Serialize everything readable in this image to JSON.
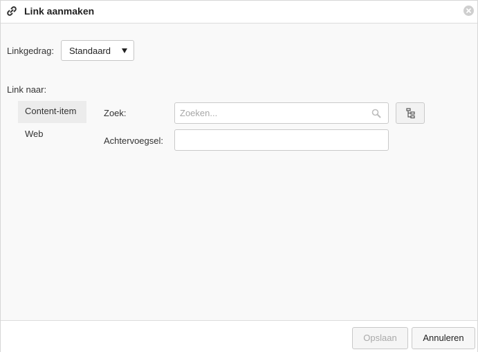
{
  "dialog": {
    "title": "Link aanmaken",
    "title_icon": "link-icon",
    "close_icon": "close-icon"
  },
  "behavior": {
    "label": "Linkgedrag:",
    "selected": "Standaard"
  },
  "link_to": {
    "label": "Link naar:",
    "tabs": [
      {
        "label": "Content-item",
        "active": true
      },
      {
        "label": "Web",
        "active": false
      }
    ]
  },
  "search": {
    "label": "Zoek:",
    "placeholder": "Zoeken...",
    "value": "",
    "icon": "search-icon",
    "tree_button_icon": "tree-icon"
  },
  "suffix": {
    "label": "Achtervoegsel:",
    "value": ""
  },
  "footer": {
    "save_label": "Opslaan",
    "cancel_label": "Annuleren"
  },
  "colors": {
    "background": "#f9f9f9",
    "border": "#dcdcdc",
    "disabled_text": "#a9a9a9",
    "active_tab": "#ececec"
  }
}
